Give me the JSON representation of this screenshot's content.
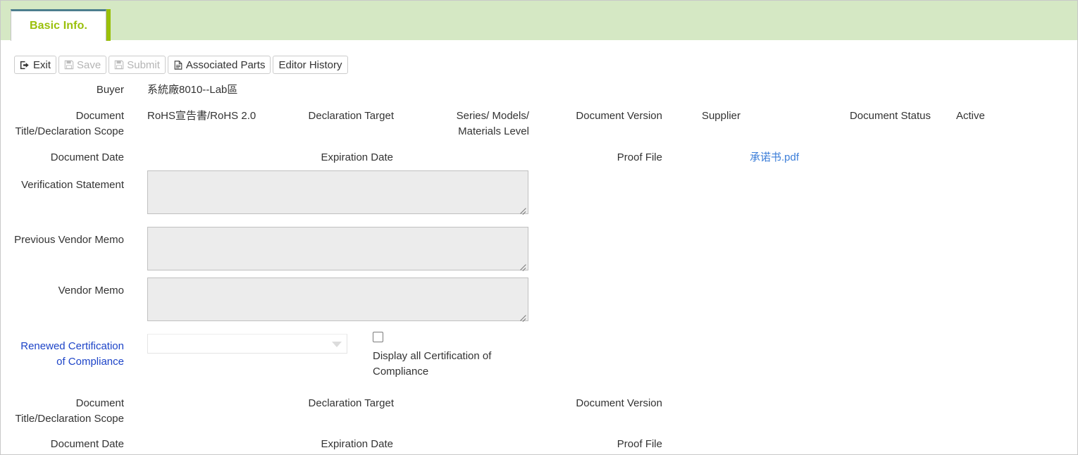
{
  "tab": {
    "label": "Basic Info.",
    "accent_color": "#9ac00a",
    "top_border_color": "#4d7e8e",
    "strip_background": "#d5e8c4"
  },
  "toolbar": {
    "exit_label": "Exit",
    "save_label": "Save",
    "submit_label": "Submit",
    "associated_parts_label": "Associated Parts",
    "editor_history_label": "Editor History"
  },
  "form": {
    "buyer_label": "Buyer",
    "buyer_value": "系統廠8010--Lab區",
    "doc_title_label_line1": "Document",
    "doc_title_label_line2": "Title/Declaration Scope",
    "doc_title_value": "RoHS宣告書/RoHS 2.0",
    "declaration_target_label": "Declaration Target",
    "declaration_target_value_line1": "Series/ Models/",
    "declaration_target_value_line2": "Materials Level",
    "document_version_label": "Document Version",
    "document_version_value": "",
    "supplier_label": "Supplier",
    "supplier_value": "",
    "document_status_label": "Document Status",
    "document_status_value": "Active",
    "document_date_label": "Document Date",
    "document_date_value": "",
    "expiration_date_label": "Expiration Date",
    "expiration_date_value": "",
    "proof_file_label": "Proof File",
    "proof_file_value": "承诺书.pdf",
    "verification_statement_label": "Verification Statement",
    "verification_statement_value": "",
    "previous_vendor_memo_label": "Previous Vendor Memo",
    "previous_vendor_memo_value": "",
    "vendor_memo_label": "Vendor Memo",
    "vendor_memo_value": "",
    "renewed_cert_label_line1": "Renewed Certification",
    "renewed_cert_label_line2": "of Compliance",
    "renewed_cert_selected": "",
    "display_all_checkbox_label": "Display all Certification of Compliance",
    "doc_title_label2_line1": "Document",
    "doc_title_label2_line2": "Title/Declaration Scope",
    "doc_title_value2": "",
    "declaration_target_label2": "Declaration Target",
    "declaration_target_value2": "",
    "document_version_label2": "Document Version",
    "document_version_value2": "",
    "document_date_label2": "Document Date",
    "document_date_value2": "",
    "expiration_date_label2": "Expiration Date",
    "expiration_date_value2": "",
    "proof_file_label2": "Proof File",
    "proof_file_value2": ""
  },
  "icons": {
    "exit": "exit-icon",
    "save": "floppy-disk-icon",
    "submit": "floppy-disk-icon",
    "associated_parts": "document-icon"
  }
}
